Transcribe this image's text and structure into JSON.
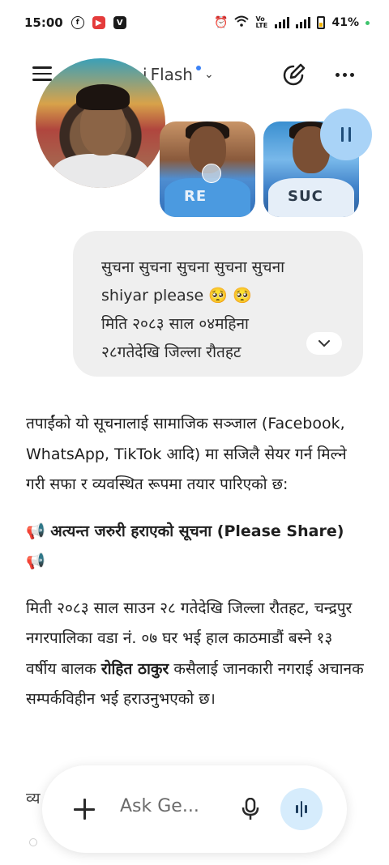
{
  "status_bar": {
    "time": "15:00",
    "network": "Vo LTE",
    "battery": "41%"
  },
  "app_bar": {
    "model_name": "Flash",
    "model_name_prefix": "i"
  },
  "user_message": {
    "lines": [
      "सुचना सुचना सुचना सुचना सुचना",
      "shiyar please 🥺 🥺",
      "मिति २०८३ साल ०४महिना",
      "२८गतेदेखि जिल्ला रौतहट"
    ]
  },
  "response": {
    "intro": "तपाईंको यो सूचनालाई सामाजिक सञ्जाल (Facebook, WhatsApp, TikTok आदि) मा सजिलै सेयर गर्न मिल्ने गरी सफा र व्यवस्थित रूपमा तयार पारिएको छ:",
    "heading": "📢 अत्यन्त जरुरी हराएको सूचना (Please Share) 📢",
    "body_before": "मिती २०८३ साल साउन २८ गतेदेखि जिल्ला रौतहट, चन्द्रपुर नगरपालिका वडा नं. ०७ घर भई हाल काठमाडौं बस्ने १३ वर्षीय बालक ",
    "body_name": "रोहित ठाकुर",
    "body_after": " कसैलाई जानकारी नगराई अचानक सम्पर्कविहीन भई हराउनुभएको छ।",
    "partial": "व्य"
  },
  "input_bar": {
    "placeholder": "Ask Ge..."
  },
  "colors": {
    "accent_blue": "#3b82f6",
    "live_button_bg": "#d6ecfc",
    "pause_button_bg": "#a9d3f7",
    "bubble_bg": "#efefef"
  },
  "icons": [
    "facebook-icon",
    "youtube-icon",
    "v-app-icon",
    "alarm-icon",
    "wifi-icon",
    "signal-icon",
    "battery-icon",
    "menu-icon",
    "chevron-down-icon",
    "new-chat-icon",
    "more-icon",
    "pause-icon",
    "expand-chevron-icon",
    "plus-icon",
    "mic-icon",
    "live-icon",
    "megaphone-icon"
  ]
}
